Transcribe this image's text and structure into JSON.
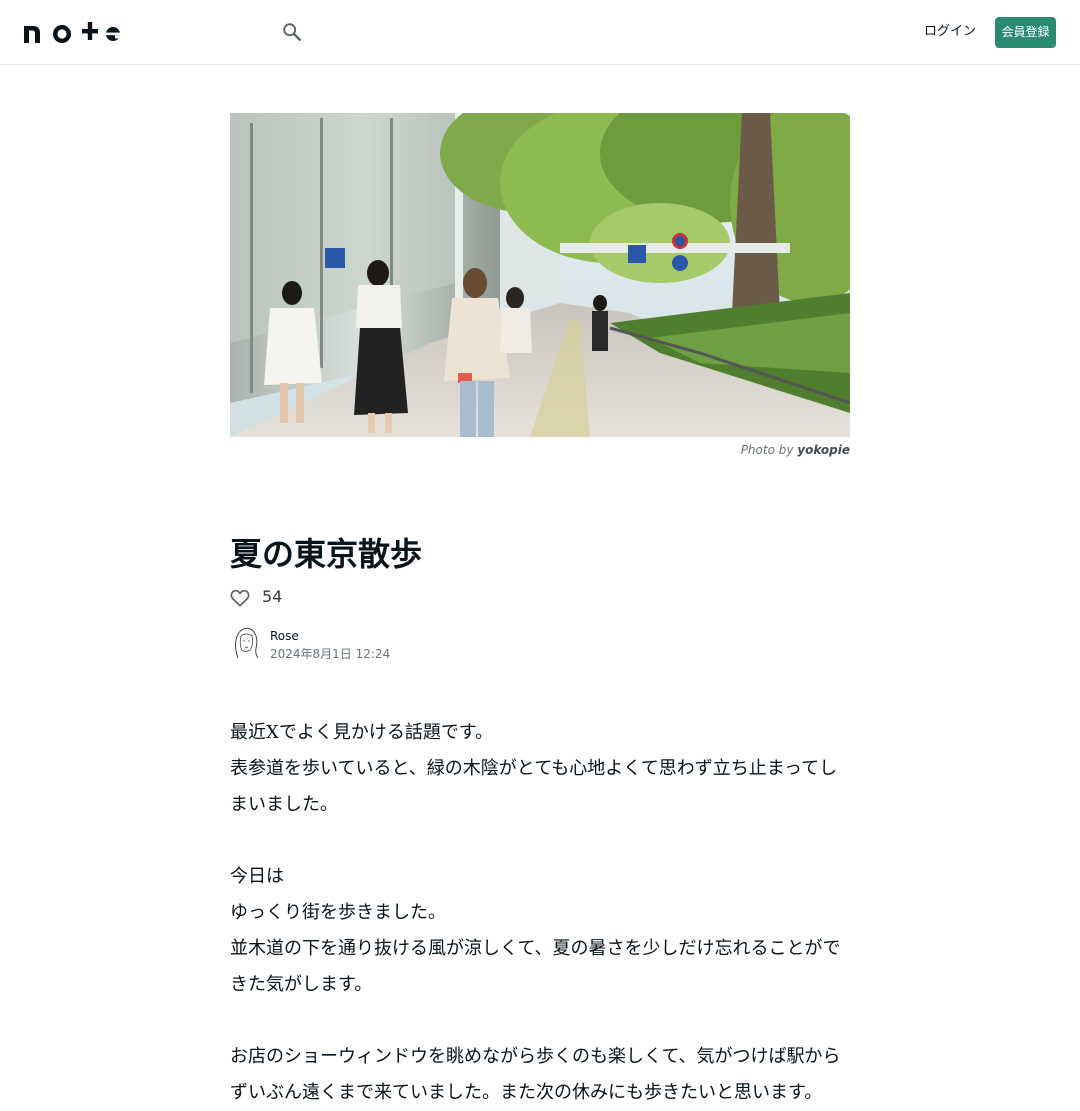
{
  "header": {
    "logo_text": "note",
    "search_icon": "search-icon",
    "login_label": "ログイン",
    "signup_label": "会員登録"
  },
  "hero": {
    "credit_prefix": "Photo by",
    "credit_author": "yokopie"
  },
  "article": {
    "title": "夏の東京散歩",
    "like_count": "54",
    "author": "Rose",
    "date": "2024年8月1日 12:24",
    "paragraphs": [
      "最近Xでよく見かける話題です。",
      "表参道を歩いていると、緑の木陰がとても心地よくて思わず立ち止まってしまいました。",
      "",
      "今日は",
      "ゆっくり街を歩きました。",
      "並木道の下を通り抜ける風が涼しくて、夏の暑さを少しだけ忘れることができた気がします。",
      "",
      "お店のショーウィンドウを眺めながら歩くのも楽しくて、気がつけば駅からずいぶん遠くまで来ていました。また次の休みにも歩きたいと思います。"
    ]
  },
  "colors": {
    "accent": "#2b8a73",
    "text": "#08131a",
    "muted": "#6b7378"
  }
}
